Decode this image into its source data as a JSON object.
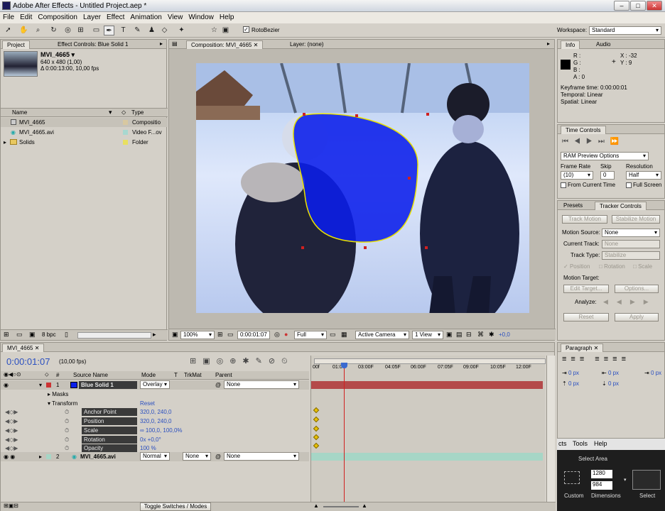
{
  "app": {
    "title": "Adobe After Effects - Untitled Project.aep *"
  },
  "menu": [
    "File",
    "Edit",
    "Composition",
    "Layer",
    "Effect",
    "Animation",
    "View",
    "Window",
    "Help"
  ],
  "toolbar": {
    "rotobezier": "RotoBezier",
    "workspace_label": "Workspace:",
    "workspace_value": "Standard"
  },
  "project": {
    "tab": "Project",
    "effect_tab": "Effect Controls: Blue Solid 1",
    "item_name": "MVI_4665 ▾",
    "item_size": "640 x 480 (1,00)",
    "item_duration": "Δ 0:00:13:00, 10,00 fps",
    "col_name": "Name",
    "col_type": "Type",
    "items": [
      {
        "name": "MVI_4665",
        "type": "Compositio"
      },
      {
        "name": "MVI_4665.avi",
        "type": "Video F...ov"
      },
      {
        "name": "Solids",
        "type": "Folder"
      }
    ],
    "bpc": "8 bpc"
  },
  "comp": {
    "tab": "Composition: MVI_4665",
    "layer_tab": "Layer: (none)",
    "zoom": "100%",
    "timecode": "0:00:01:07",
    "resolution": "Full",
    "camera": "Active Camera",
    "views": "1 View",
    "offset": "+0,0"
  },
  "info": {
    "tab": "Info",
    "audio_tab": "Audio",
    "r": "R :",
    "g": "G :",
    "b": "B :",
    "a": "A : 0",
    "x": "X : -32",
    "y": "Y : 9",
    "keyframe_time": "Keyframe time: 0:00:00:01",
    "temporal": "Temporal: Linear",
    "spatial": "Spatial: Linear"
  },
  "time_controls": {
    "tab": "Time Controls",
    "ram_preview": "RAM Preview Options",
    "frame_rate_label": "Frame Rate",
    "skip_label": "Skip",
    "resolution_label": "Resolution",
    "frame_rate": "(10)",
    "skip": "0",
    "resolution": "Half",
    "from_current": "From Current Time",
    "full_screen": "Full Screen"
  },
  "tracker": {
    "presets_tab": "Presets",
    "tab": "Tracker Controls",
    "track_motion": "Track Motion",
    "stabilize_motion": "Stabilize Motion",
    "motion_source_label": "Motion Source:",
    "motion_source": "None",
    "current_track_label": "Current Track:",
    "current_track": "None",
    "track_type_label": "Track Type:",
    "track_type": "Stabilize",
    "position": "Position",
    "rotation": "Rotation",
    "scale": "Scale",
    "motion_target": "Motion Target:",
    "edit_target": "Edit Target...",
    "options": "Options...",
    "analyze": "Analyze:",
    "reset": "Reset",
    "apply": "Apply"
  },
  "timeline": {
    "tab": "MVI_4665",
    "timecode": "0:00:01:07",
    "fps": "(10,00 fps)",
    "col_source": "Source Name",
    "col_mode": "Mode",
    "col_t": "T",
    "col_trkmat": "TrkMat",
    "col_parent": "Parent",
    "ruler": [
      "00f",
      "01:0",
      "03:00F",
      "04:05F",
      "06:00F",
      "07:05F",
      "09:00F",
      "10:05F",
      "12:00F"
    ],
    "layers": [
      {
        "num": "1",
        "name": "Blue Solid 1",
        "mode": "Overlay",
        "parent": "None"
      },
      {
        "num": "2",
        "name": "MVI_4665.avi",
        "mode": "Normal",
        "trkmat": "None",
        "parent": "None"
      }
    ],
    "masks": "Masks",
    "transform": "Transform",
    "reset": "Reset",
    "props": [
      {
        "name": "Anchor Point",
        "value": "320,0, 240,0"
      },
      {
        "name": "Position",
        "value": "320,0, 240,0"
      },
      {
        "name": "Scale",
        "value": "∞ 100,0, 100,0%"
      },
      {
        "name": "Rotation",
        "value": "0x +0,0°"
      },
      {
        "name": "Opacity",
        "value": "100 %"
      }
    ],
    "toggle": "Toggle Switches / Modes"
  },
  "paragraph": {
    "tab": "Paragraph",
    "px1": "0 px",
    "px2": "0 px",
    "px3": "0 px",
    "px4": "0 px",
    "px5": "0 px"
  },
  "overlay": {
    "menu_fragment": "cts",
    "tools": "Tools",
    "help": "Help",
    "select_area": "Select Area",
    "width": "1280",
    "height": "984",
    "custom": "Custom",
    "dimensions": "Dimensions",
    "select": "Select"
  },
  "colors": {
    "accent": "#e8c000",
    "solid": "#0a1eea",
    "layer_bar": "#b44a4a",
    "video_bar": "#a6d6c6"
  }
}
